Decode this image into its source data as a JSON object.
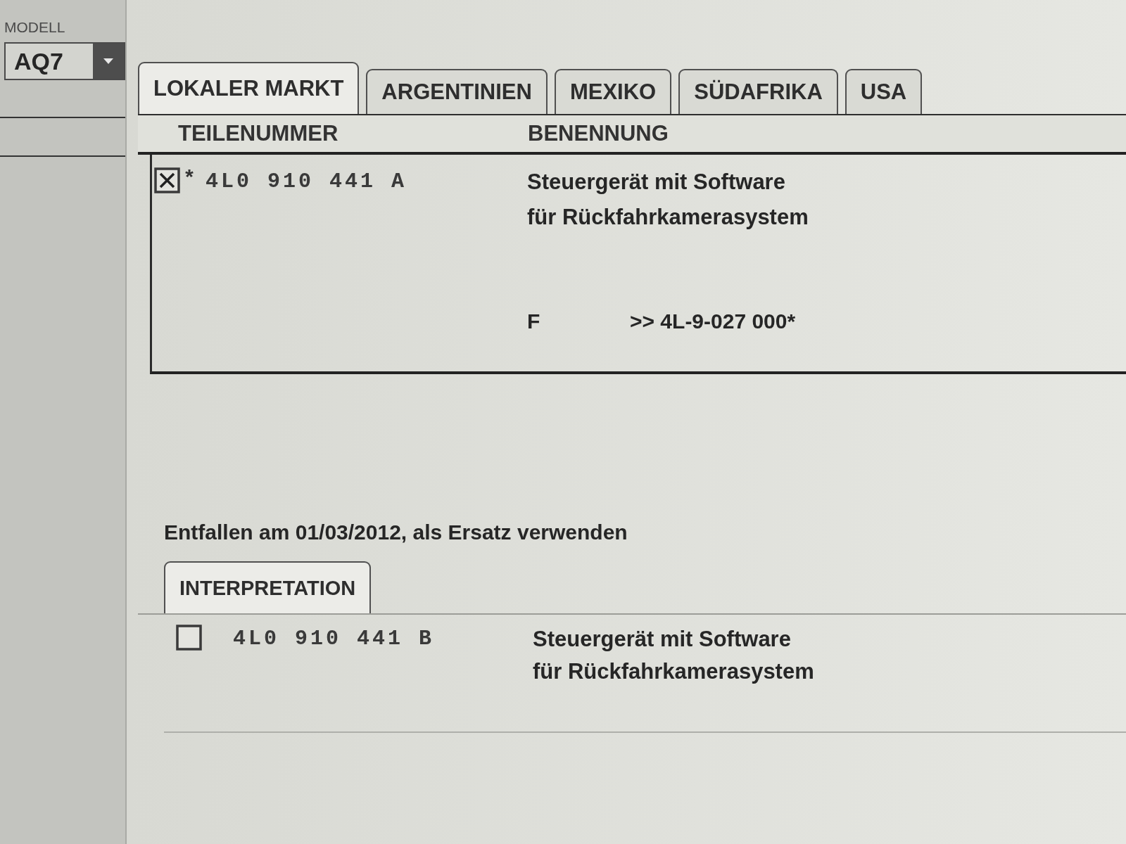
{
  "sidebar": {
    "label": "MODELL",
    "model": "AQ7"
  },
  "tabs": [
    {
      "label": "LOKALER MARKT",
      "selected": true
    },
    {
      "label": "ARGENTINIEN",
      "selected": false
    },
    {
      "label": "MEXIKO",
      "selected": false
    },
    {
      "label": "SÜDAFRIKA",
      "selected": false
    },
    {
      "label": "USA",
      "selected": false
    }
  ],
  "table": {
    "columns": [
      "TEILENUMMER",
      "BENENNUNG"
    ],
    "rows": [
      {
        "checked": true,
        "marker": "*",
        "part_number": "4L0 910 441 A",
        "description": [
          "Steuergerät mit Software",
          "für Rückfahrkamerasystem"
        ],
        "note_code": "F",
        "note_reference": ">> 4L-9-027 000*"
      }
    ]
  },
  "status_message": "Entfallen am 01/03/2012, als Ersatz verwenden",
  "replacement": {
    "tabs": [
      {
        "label": "INTERPRETATION",
        "selected": true
      }
    ],
    "rows": [
      {
        "checked": false,
        "part_number": "4L0 910 441 B",
        "description": [
          "Steuergerät mit Software",
          "für Rückfahrkamerasystem"
        ]
      }
    ]
  }
}
